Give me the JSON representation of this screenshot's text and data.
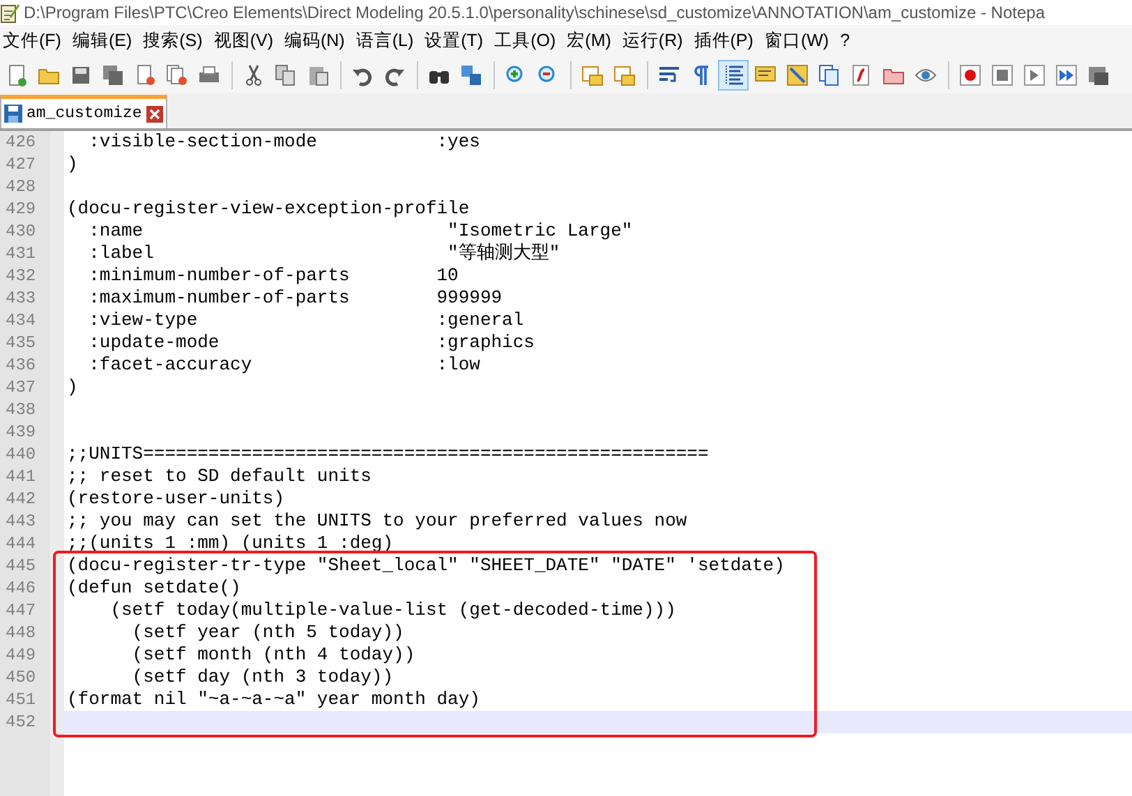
{
  "window": {
    "title": "D:\\Program Files\\PTC\\Creo Elements\\Direct Modeling 20.5.1.0\\personality\\schinese\\sd_customize\\ANNOTATION\\am_customize - Notepa"
  },
  "menu": [
    "文件(F)",
    "编辑(E)",
    "搜索(S)",
    "视图(V)",
    "编码(N)",
    "语言(L)",
    "设置(T)",
    "工具(O)",
    "宏(M)",
    "运行(R)",
    "插件(P)",
    "窗口(W)",
    "?"
  ],
  "toolbar": [
    [
      {
        "kind": "new",
        "selected": false
      },
      {
        "kind": "open",
        "selected": false
      },
      {
        "kind": "save",
        "selected": false
      },
      {
        "kind": "saveall",
        "selected": false
      },
      {
        "kind": "close",
        "selected": false
      },
      {
        "kind": "closeall",
        "selected": false
      },
      {
        "kind": "print",
        "selected": false
      }
    ],
    [
      {
        "kind": "cut",
        "selected": false
      },
      {
        "kind": "copy",
        "selected": false
      },
      {
        "kind": "paste",
        "selected": false
      }
    ],
    [
      {
        "kind": "undo",
        "selected": false
      },
      {
        "kind": "redo",
        "selected": false
      }
    ],
    [
      {
        "kind": "find",
        "selected": false
      },
      {
        "kind": "replace",
        "selected": false
      }
    ],
    [
      {
        "kind": "zoomin",
        "selected": false
      },
      {
        "kind": "zoomout",
        "selected": false
      }
    ],
    [
      {
        "kind": "syncv",
        "selected": false
      },
      {
        "kind": "synch",
        "selected": false
      }
    ],
    [
      {
        "kind": "wrap",
        "selected": false
      },
      {
        "kind": "pilcrow",
        "selected": false
      },
      {
        "kind": "indent",
        "selected": true
      },
      {
        "kind": "lang",
        "selected": false
      },
      {
        "kind": "map",
        "selected": false
      },
      {
        "kind": "docs",
        "selected": false
      },
      {
        "kind": "func",
        "selected": false
      },
      {
        "kind": "folder",
        "selected": false
      },
      {
        "kind": "eye",
        "selected": false
      }
    ],
    [
      {
        "kind": "record",
        "selected": false
      },
      {
        "kind": "stop",
        "selected": false
      },
      {
        "kind": "play",
        "selected": false
      },
      {
        "kind": "playmulti",
        "selected": false
      },
      {
        "kind": "savemacro",
        "selected": false
      }
    ]
  ],
  "tabs": [
    {
      "label": "am_customize",
      "selected": true
    }
  ],
  "editor": {
    "lines": [
      {
        "number": "426",
        "text": "  :visible-section-mode           :yes"
      },
      {
        "number": "427",
        "text": ")"
      },
      {
        "number": "428"
      },
      {
        "number": "429",
        "text": "(docu-register-view-exception-profile"
      },
      {
        "number": "430",
        "text": "  :name                            \"Isometric Large\""
      },
      {
        "number": "431",
        "text": "  :label                           \"等轴测大型\""
      },
      {
        "number": "432",
        "text": "  :minimum-number-of-parts        10"
      },
      {
        "number": "433",
        "text": "  :maximum-number-of-parts        999999"
      },
      {
        "number": "434",
        "text": "  :view-type                      :general"
      },
      {
        "number": "435",
        "text": "  :update-mode                    :graphics"
      },
      {
        "number": "436",
        "text": "  :facet-accuracy                 :low"
      },
      {
        "number": "437",
        "text": ")"
      },
      {
        "number": "438"
      },
      {
        "number": "439"
      },
      {
        "number": "440",
        "text": ";;UNITS===================================================="
      },
      {
        "number": "441",
        "text": ";; reset to SD default units"
      },
      {
        "number": "442",
        "text": "(restore-user-units)"
      },
      {
        "number": "443",
        "text": ";; you may can set the UNITS to your preferred values now"
      },
      {
        "number": "444",
        "text": ";;(units 1 :mm) (units 1 :deg)"
      }
    ],
    "highlight_box": {
      "lines": [
        {
          "number": "445",
          "text": "(docu-register-tr-type \"Sheet_local\" \"SHEET_DATE\" \"DATE\" 'setdate)"
        },
        {
          "number": "446",
          "text": "(defun setdate()"
        },
        {
          "number": "447",
          "text": "    (setf today(multiple-value-list (get-decoded-time)))"
        },
        {
          "number": "448",
          "text": "      (setf year (nth 5 today))"
        },
        {
          "number": "449",
          "text": "      (setf month (nth 4 today))"
        },
        {
          "number": "450",
          "text": "      (setf day (nth 3 today))"
        },
        {
          "number": "451",
          "text": "(format nil \"~a-~a-~a\" year month day)"
        }
      ],
      "current_line": {
        "number": "452"
      }
    }
  }
}
